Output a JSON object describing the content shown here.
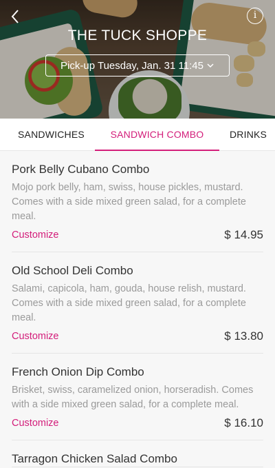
{
  "header": {
    "store_name": "THE TUCK SHOPPE",
    "pickup_label": "Pick-up Tuesday, Jan. 31 11:45",
    "back_icon": "chevron-left-icon",
    "info_icon": "info-icon",
    "info_glyph": "i"
  },
  "tabs": [
    {
      "label": "SANDWICHES"
    },
    {
      "label": "SANDWICH COMBO",
      "active": true
    },
    {
      "label": "DRINKS"
    }
  ],
  "colors": {
    "accent": "#d31d7a"
  },
  "items": [
    {
      "name": "Pork Belly Cubano Combo",
      "description": "Mojo pork belly, ham, swiss, house pickles, mustard. Comes with a side mixed green salad, for a complete meal.",
      "action": "Customize",
      "price": "$ 14.95"
    },
    {
      "name": "Old School Deli Combo",
      "description": "Salami, capicola, ham, gouda, house relish, mustard. Comes with a side mixed green salad, for a complete meal.",
      "action": "Customize",
      "price": "$ 13.80"
    },
    {
      "name": "French Onion Dip Combo",
      "description": "Brisket, swiss, caramelized onion, horseradish. Comes with a side mixed green salad, for a complete meal.",
      "action": "Customize",
      "price": "$ 16.10"
    },
    {
      "name": "Tarragon Chicken Salad Combo"
    }
  ]
}
